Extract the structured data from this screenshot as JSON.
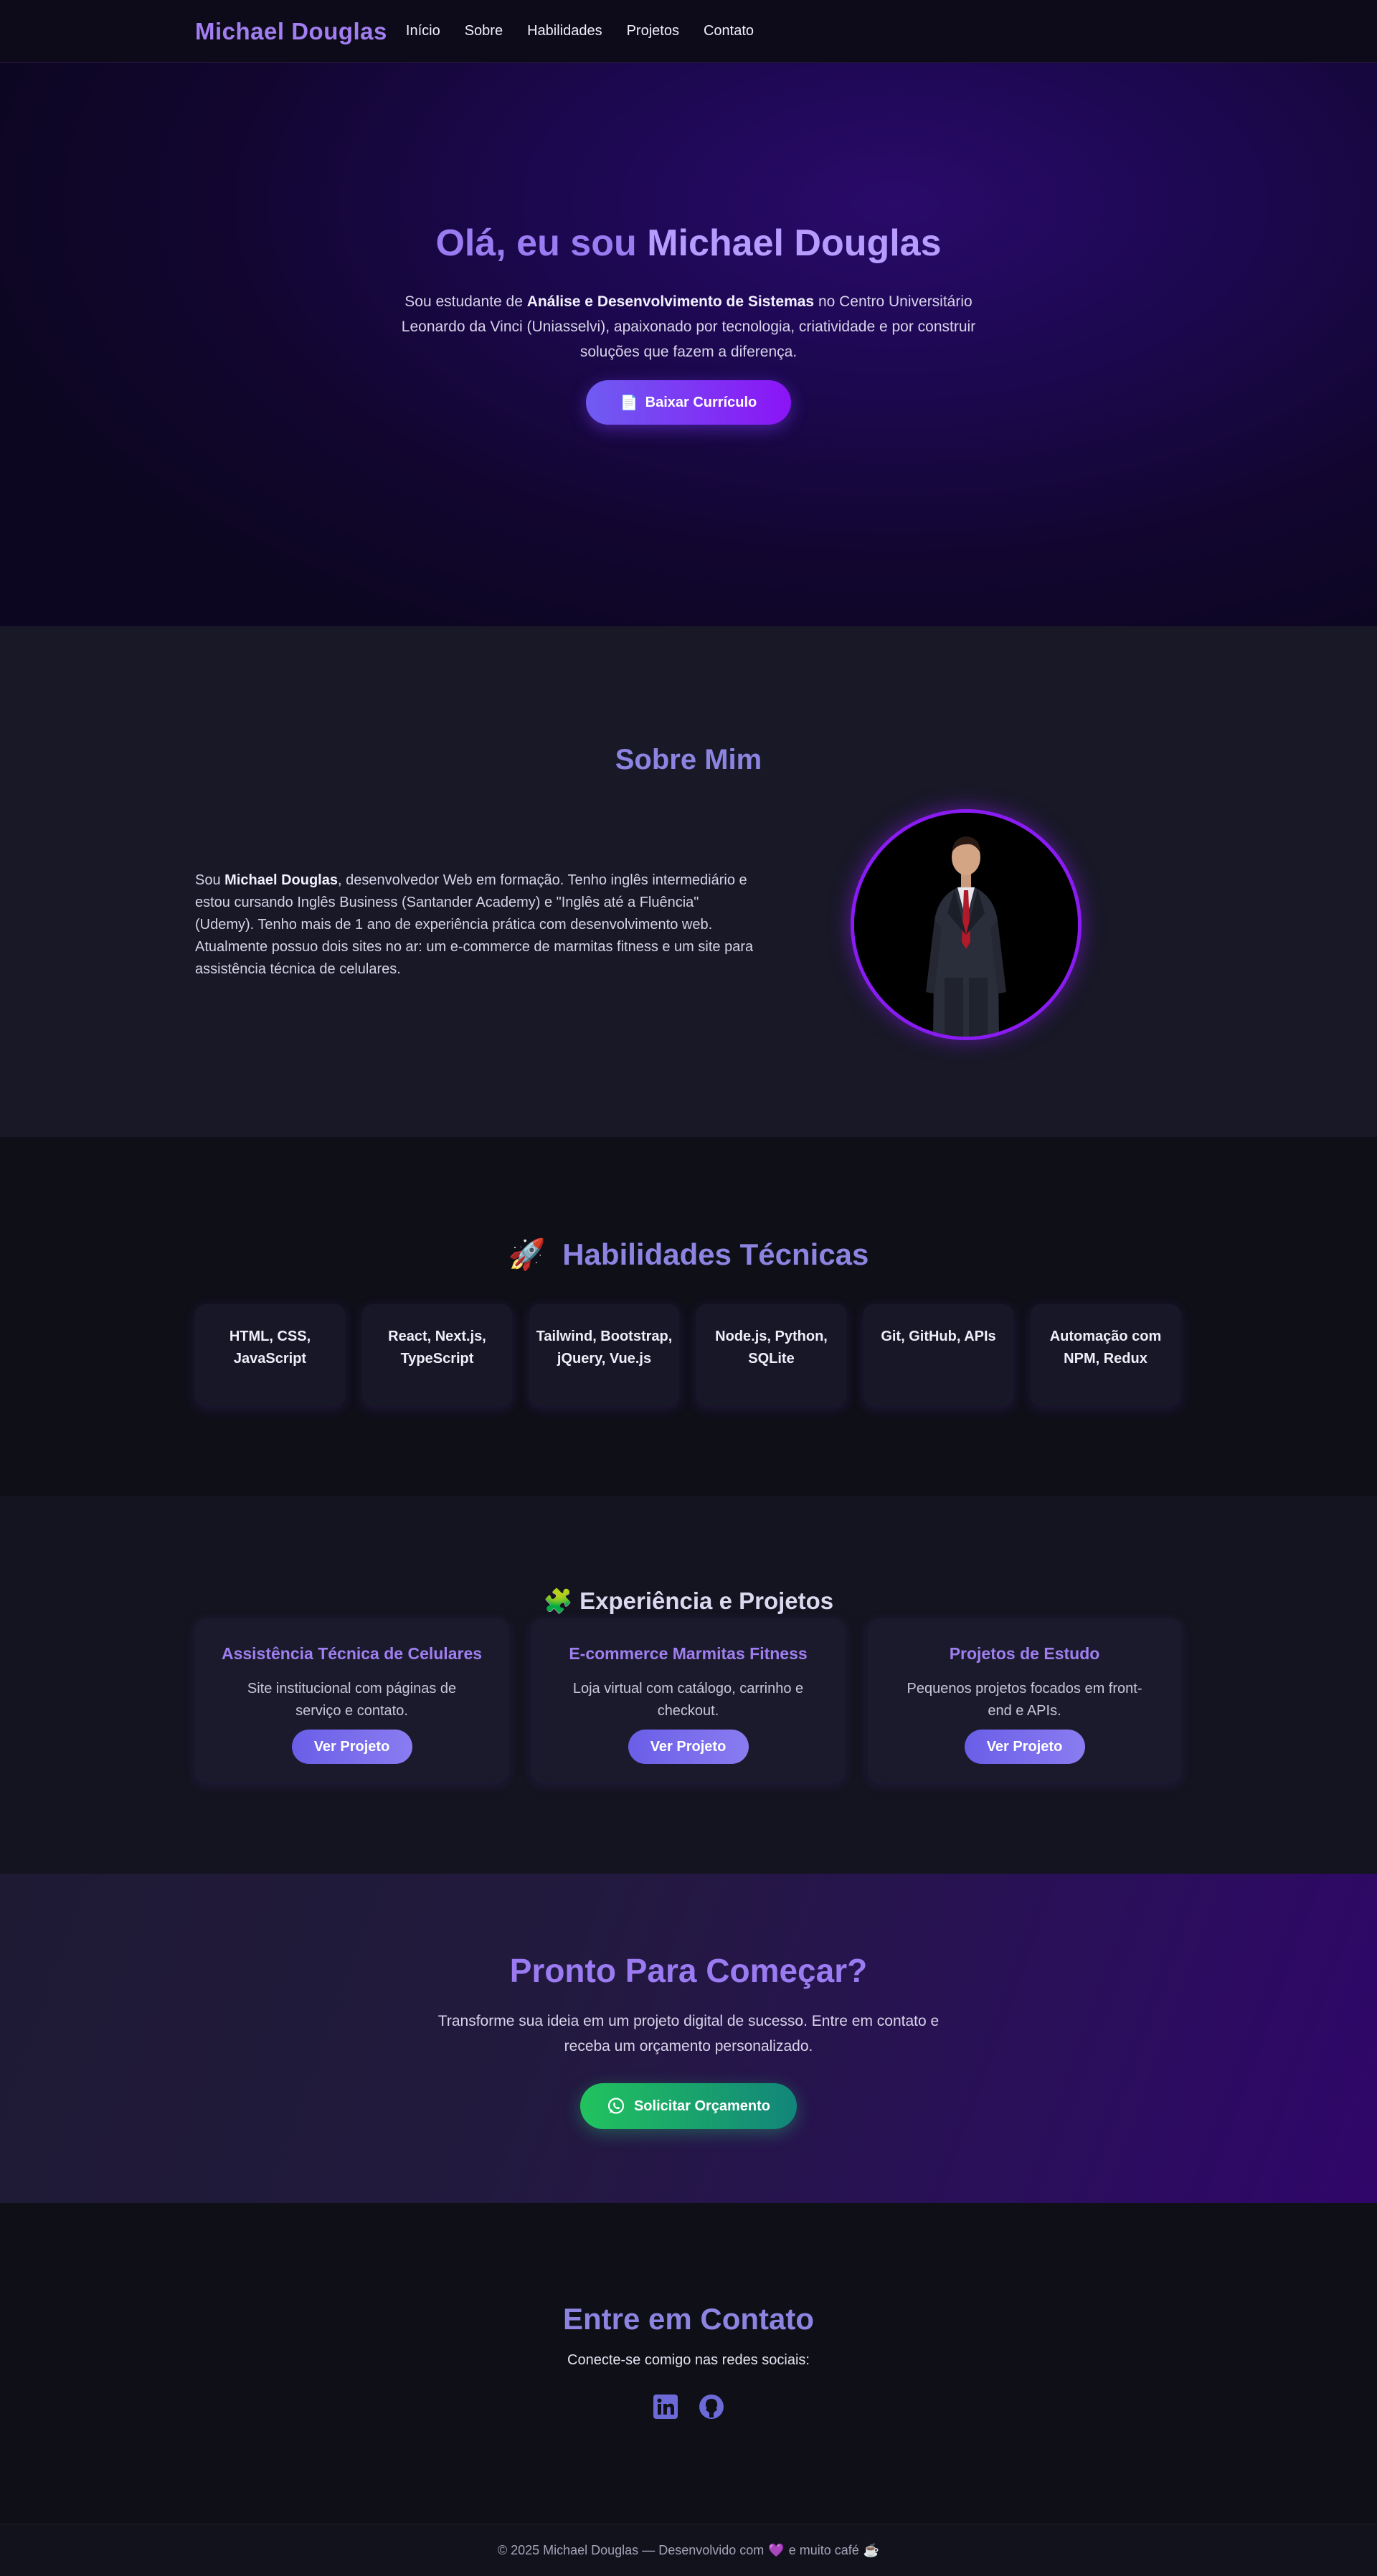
{
  "nav": {
    "brand": "Michael Douglas",
    "links": [
      "Início",
      "Sobre",
      "Habilidades",
      "Projetos",
      "Contato"
    ]
  },
  "hero": {
    "title_prefix": "Olá, eu sou ",
    "title_name": "Michael Douglas",
    "desc_1": "Sou estudante de ",
    "desc_bold": "Análise e Desenvolvimento de Sistemas",
    "desc_2": " no Centro Universitário Leonardo da Vinci (Uniasselvi), apaixonado por tecnologia, criatividade e por construir soluções que fazem a diferença.",
    "button_icon": "📄",
    "button_label": "Baixar Currículo"
  },
  "about": {
    "title": "Sobre Mim",
    "text_1": "Sou ",
    "text_bold": "Michael Douglas",
    "text_2": ", desenvolvedor Web em formação. Tenho inglês intermediário e estou cursando Inglês Business (Santander Academy) e \"Inglês até a Fluência\" (Udemy). Tenho mais de 1 ano de experiência prática com desenvolvimento web. Atualmente possuo dois sites no ar: um e-commerce de marmitas fitness e um site para assistência técnica de celulares."
  },
  "skills": {
    "icon": "🚀",
    "title": "Habilidades Técnicas",
    "items": [
      "HTML, CSS, JavaScript",
      "React, Next.js, TypeScript",
      "Tailwind, Bootstrap, jQuery, Vue.js",
      "Node.js, Python, SQLite",
      "Git, GitHub, APIs",
      "Automação com NPM, Redux"
    ]
  },
  "projects": {
    "icon": "🧩",
    "title": "Experiência e Projetos",
    "button_label": "Ver Projeto",
    "items": [
      {
        "title": "Assistência Técnica de Celulares",
        "desc": "Site institucional com páginas de serviço e contato."
      },
      {
        "title": "E-commerce Marmitas Fitness",
        "desc": "Loja virtual com catálogo, carrinho e checkout."
      },
      {
        "title": "Projetos de Estudo",
        "desc": "Pequenos projetos focados em front-end e APIs."
      }
    ]
  },
  "cta": {
    "title": "Pronto Para Começar?",
    "text": "Transforme sua ideia em um projeto digital de sucesso. Entre em contato e receba um orçamento personalizado.",
    "button_label": "Solicitar Orçamento"
  },
  "contact": {
    "title": "Entre em Contato",
    "subtitle": "Conecte-se comigo nas redes sociais:"
  },
  "footer": {
    "text_1": "© 2025 Michael Douglas — Desenvolvido com",
    "heart": "💜",
    "text_2": "e muito café",
    "coffee": "☕"
  },
  "colors": {
    "accent": "#9b7bf2",
    "button_gradient_start": "#6f5cf2",
    "button_gradient_end": "#8b14f6",
    "whatsapp_green": "#21c35e"
  }
}
